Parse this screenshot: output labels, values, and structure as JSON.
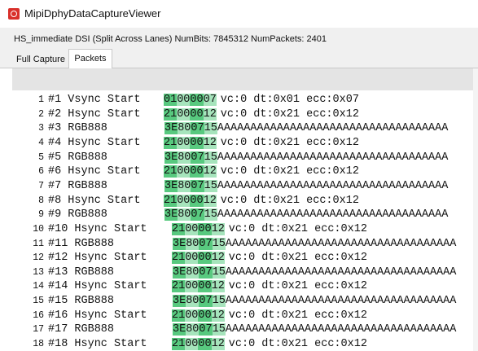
{
  "window": {
    "title": "MipiDphyDataCaptureViewer",
    "icon": "app-logo-icon"
  },
  "info": {
    "text": "HS_immediate DSI (Split Across Lanes)   NumBits: 7845312  NumPackets: 2401"
  },
  "tabs": [
    {
      "label": "Full Capture",
      "active": false
    },
    {
      "label": "Packets",
      "active": true
    }
  ],
  "colors": {
    "highlight_dark": "#58c97f",
    "highlight_light": "#a6e4bc",
    "app_icon": "#d9302b"
  },
  "packets": [
    {
      "line": "1",
      "label": "#1 Vsync Start",
      "hex": [
        "01",
        "00",
        "00",
        "07"
      ],
      "rest": "vc:0 dt:0x01 ecc:0x07"
    },
    {
      "line": "2",
      "label": "#2 Hsync Start",
      "hex": [
        "21",
        "00",
        "00",
        "12"
      ],
      "rest": "vc:0 dt:0x21 ecc:0x12"
    },
    {
      "line": "3",
      "label": "#3 RGB888",
      "hex": [
        "3E",
        "80",
        "07",
        "15"
      ],
      "rest": "AAAAAAAAAAAAAAAAAAAAAAAAAAAAAAAAAAA"
    },
    {
      "line": "4",
      "label": "#4 Hsync Start",
      "hex": [
        "21",
        "00",
        "00",
        "12"
      ],
      "rest": "vc:0 dt:0x21 ecc:0x12"
    },
    {
      "line": "5",
      "label": "#5 RGB888",
      "hex": [
        "3E",
        "80",
        "07",
        "15"
      ],
      "rest": "AAAAAAAAAAAAAAAAAAAAAAAAAAAAAAAAAAA"
    },
    {
      "line": "6",
      "label": "#6 Hsync Start",
      "hex": [
        "21",
        "00",
        "00",
        "12"
      ],
      "rest": "vc:0 dt:0x21 ecc:0x12"
    },
    {
      "line": "7",
      "label": "#7 RGB888",
      "hex": [
        "3E",
        "80",
        "07",
        "15"
      ],
      "rest": "AAAAAAAAAAAAAAAAAAAAAAAAAAAAAAAAAAA"
    },
    {
      "line": "8",
      "label": "#8 Hsync Start",
      "hex": [
        "21",
        "00",
        "00",
        "12"
      ],
      "rest": "vc:0 dt:0x21 ecc:0x12"
    },
    {
      "line": "9",
      "label": "#9 RGB888",
      "hex": [
        "3E",
        "80",
        "07",
        "15"
      ],
      "rest": "AAAAAAAAAAAAAAAAAAAAAAAAAAAAAAAAAAA"
    },
    {
      "line": "10",
      "label": "#10 Hsync Start",
      "hex": [
        "21",
        "00",
        "00",
        "12"
      ],
      "rest": "vc:0 dt:0x21 ecc:0x12"
    },
    {
      "line": "11",
      "label": "#11 RGB888",
      "hex": [
        "3E",
        "80",
        "07",
        "15"
      ],
      "rest": "AAAAAAAAAAAAAAAAAAAAAAAAAAAAAAAAAAA"
    },
    {
      "line": "12",
      "label": "#12 Hsync Start",
      "hex": [
        "21",
        "00",
        "00",
        "12"
      ],
      "rest": "vc:0 dt:0x21 ecc:0x12"
    },
    {
      "line": "13",
      "label": "#13 RGB888",
      "hex": [
        "3E",
        "80",
        "07",
        "15"
      ],
      "rest": "AAAAAAAAAAAAAAAAAAAAAAAAAAAAAAAAAAA"
    },
    {
      "line": "14",
      "label": "#14 Hsync Start",
      "hex": [
        "21",
        "00",
        "00",
        "12"
      ],
      "rest": "vc:0 dt:0x21 ecc:0x12"
    },
    {
      "line": "15",
      "label": "#15 RGB888",
      "hex": [
        "3E",
        "80",
        "07",
        "15"
      ],
      "rest": "AAAAAAAAAAAAAAAAAAAAAAAAAAAAAAAAAAA"
    },
    {
      "line": "16",
      "label": "#16 Hsync Start",
      "hex": [
        "21",
        "00",
        "00",
        "12"
      ],
      "rest": "vc:0 dt:0x21 ecc:0x12"
    },
    {
      "line": "17",
      "label": "#17 RGB888",
      "hex": [
        "3E",
        "80",
        "07",
        "15"
      ],
      "rest": "AAAAAAAAAAAAAAAAAAAAAAAAAAAAAAAAAAA"
    },
    {
      "line": "18",
      "label": "#18 Hsync Start",
      "hex": [
        "21",
        "00",
        "00",
        "12"
      ],
      "rest": "vc:0 dt:0x21 ecc:0x12"
    }
  ]
}
